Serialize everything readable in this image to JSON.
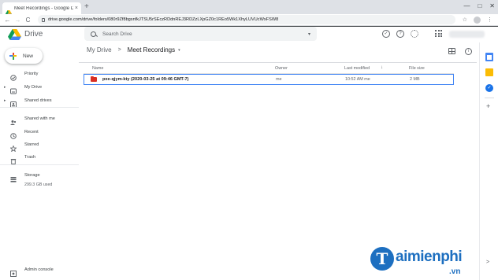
{
  "browser": {
    "tab_title": "Meet Recordings - Google Drive",
    "tab_close": "×",
    "new_tab": "+",
    "window_controls": [
      "—",
      "□",
      "✕"
    ],
    "url": "drive.google.com/drive/folders/080r9Zf8bgsnfkJTSU5rSEczRDdnREJ3RDZzLXpGZ0c1REo5Wk1XhyLUVUcWxFSW8",
    "nav": {
      "back": "←",
      "forward": "→",
      "reload": "C"
    },
    "toolbar_icons": [
      "☆",
      "⋮"
    ]
  },
  "drive": {
    "logo_text": "Drive",
    "search": {
      "placeholder": "Search Drive",
      "caret": "▾"
    },
    "header_icons": [
      "support-icon",
      "help-icon",
      "settings-icon",
      "apps-icon"
    ],
    "new_button": "New",
    "sidebar": {
      "items": [
        {
          "label": "Priority",
          "icon": "checkbox-circle-icon"
        },
        {
          "label": "My Drive",
          "icon": "my-drive-icon",
          "expand": "▸"
        },
        {
          "label": "Shared drives",
          "icon": "shared-drives-icon",
          "expand": "▸"
        },
        {
          "label": "Shared with me",
          "icon": "people-icon"
        },
        {
          "label": "Recent",
          "icon": "clock-icon"
        },
        {
          "label": "Starred",
          "icon": "star-icon"
        },
        {
          "label": "Trash",
          "icon": "trash-icon"
        },
        {
          "label": "Storage",
          "icon": "storage-icon"
        },
        {
          "label": "Admin console",
          "icon": "admin-icon"
        }
      ],
      "storage_used": "299.3 GB used"
    },
    "breadcrumb": {
      "root": "My Drive",
      "separator": ">",
      "current": "Meet Recordings",
      "caret": "▾"
    },
    "columns": {
      "name": "Name",
      "owner": "Owner",
      "last_modified": "Last modified",
      "file_size": "File size",
      "sort_arrow": "↓"
    },
    "files": [
      {
        "name": "pxe-qjym-kty (2020-03-25 at 09:46 GMT-7)",
        "owner": "me",
        "last_modified": "10:52 AM me",
        "file_size": "2 MB"
      }
    ],
    "side_panel": {
      "tasks_glyph": "✓",
      "add": "+",
      "collapse": ">"
    }
  },
  "watermark": {
    "letter": "T",
    "text": "aimienphi",
    "domain": ".vn"
  },
  "colors": {
    "accent": "#1a73e8",
    "selected_border": "#4285f4",
    "folder_red": "#d93025",
    "watermark_blue": "#1d6fc0"
  }
}
